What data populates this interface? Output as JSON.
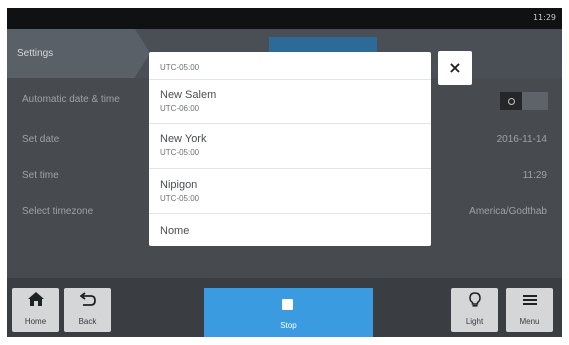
{
  "status_bar": {
    "time": "11:29"
  },
  "breadcrumb": {
    "current": "Settings"
  },
  "settings": {
    "automatic_date_time": {
      "label": "Automatic date & time",
      "enabled": false
    },
    "set_date": {
      "label": "Set date",
      "value": "2016-11-14"
    },
    "set_time": {
      "label": "Set time",
      "value": "11:29"
    },
    "select_timezone": {
      "label": "Select timezone",
      "value": "America/Godthab"
    }
  },
  "timezone_picker": {
    "partial_top_offset": "UTC-05:00",
    "items": [
      {
        "city": "New Salem",
        "offset": "UTC-06:00"
      },
      {
        "city": "New York",
        "offset": "UTC-05:00"
      },
      {
        "city": "Nipigon",
        "offset": "UTC-05:00"
      },
      {
        "city": "Nome",
        "offset": ""
      }
    ],
    "close_icon": "close-icon"
  },
  "bottom_nav": {
    "home": {
      "label": "Home",
      "icon": "home-icon"
    },
    "back": {
      "label": "Back",
      "icon": "back-icon"
    },
    "stop": {
      "label": "Stop",
      "icon": "stop-icon"
    },
    "light": {
      "label": "Light",
      "icon": "lightbulb-icon"
    },
    "menu": {
      "label": "Menu",
      "icon": "menu-icon"
    }
  },
  "colors": {
    "accent": "#3b9be0",
    "background": "#d4d5d6",
    "dim_overlay": "#474b50"
  }
}
